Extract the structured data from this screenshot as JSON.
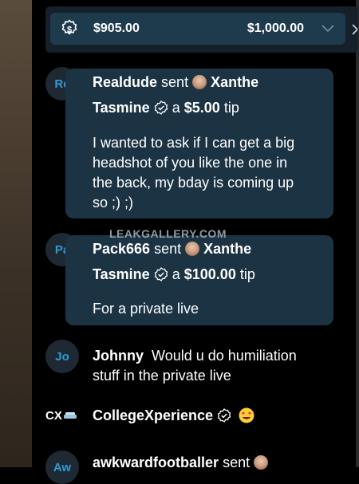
{
  "goal": {
    "current": "$905.00",
    "target": "$1,000.00",
    "icon": "gear-dollar-icon",
    "chevron": "chevron-down-icon"
  },
  "watermark": "LEAKGALLERY.COM",
  "messages": [
    {
      "avatar": "Re",
      "user": "Realdude",
      "sent_word": "sent",
      "recipient_first": "Xanthe",
      "recipient_last": "Tasmine",
      "tip_prefix": "a",
      "tip_amount": "$5.00",
      "tip_word": "tip",
      "body_lines": [
        "I wanted to ask if I can get a big",
        "headshot of you like the one in",
        "the back, my bday is coming up",
        "so ;) ;)"
      ]
    },
    {
      "avatar": "Pa",
      "user": "Pack666",
      "sent_word": "sent",
      "recipient_first": "Xanthe",
      "recipient_last": "Tasmine",
      "tip_prefix": "a",
      "tip_amount": "$100.00",
      "tip_word": "tip",
      "body_lines": [
        "For a private live"
      ]
    },
    {
      "avatar": "Jo",
      "user": "Johnny",
      "body_lines": [
        "Would u do humiliation",
        "stuff in the private live"
      ]
    },
    {
      "avatar": "CX",
      "user": "CollegeXperience",
      "emoji": "heart-eyes-emoji"
    },
    {
      "avatar": "Aw",
      "user": "awkwardfootballer",
      "sent_word": "sent"
    }
  ]
}
